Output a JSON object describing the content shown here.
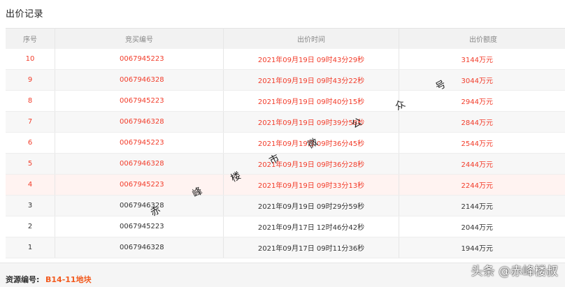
{
  "page": {
    "title": "出价记录"
  },
  "table": {
    "headers": [
      "序号",
      "竞买编号",
      "出价时间",
      "出价额度"
    ],
    "rows": [
      {
        "no": "10",
        "code": "0067945223",
        "time": "2021年09月19日 09时43分29秒",
        "amount": "3144万元",
        "highlight": true
      },
      {
        "no": "9",
        "code": "0067946328",
        "time": "2021年09月19日 09时43分22秒",
        "amount": "3044万元",
        "highlight": true
      },
      {
        "no": "8",
        "code": "0067945223",
        "time": "2021年09月19日 09时40分15秒",
        "amount": "2944万元",
        "highlight": true
      },
      {
        "no": "7",
        "code": "0067946328",
        "time": "2021年09月19日 09时39分58秒",
        "amount": "2844万元",
        "highlight": true
      },
      {
        "no": "6",
        "code": "0067945223",
        "time": "2021年09月19日 09时36分45秒",
        "amount": "2544万元",
        "highlight": true
      },
      {
        "no": "5",
        "code": "0067946328",
        "time": "2021年09月19日 09时36分28秒",
        "amount": "2444万元",
        "highlight": true
      },
      {
        "no": "4",
        "code": "0067945223",
        "time": "2021年09月19日 09时33分13秒",
        "amount": "2244万元",
        "highlight": true
      },
      {
        "no": "3",
        "code": "0067946328",
        "time": "2021年09月19日 09时29分59秒",
        "amount": "2144万元",
        "highlight": false
      },
      {
        "no": "2",
        "code": "0067945223",
        "time": "2021年09月17日 12时46分42秒",
        "amount": "2044万元",
        "highlight": false
      },
      {
        "no": "1",
        "code": "0067946328",
        "time": "2021年09月17日 09时11分36秒",
        "amount": "1944万元",
        "highlight": false
      }
    ]
  },
  "footer": {
    "resource_label": "资源编号:",
    "resource_value": "B14-11地块"
  },
  "watermark": {
    "chars": [
      "赤",
      "峰",
      "楼",
      "市",
      "微",
      "公",
      "众",
      "号"
    ],
    "corner": "头条 @赤峰楼叔"
  },
  "colors": {
    "highlight_text": "#f23c2a",
    "resource_value": "#f25a1e"
  }
}
